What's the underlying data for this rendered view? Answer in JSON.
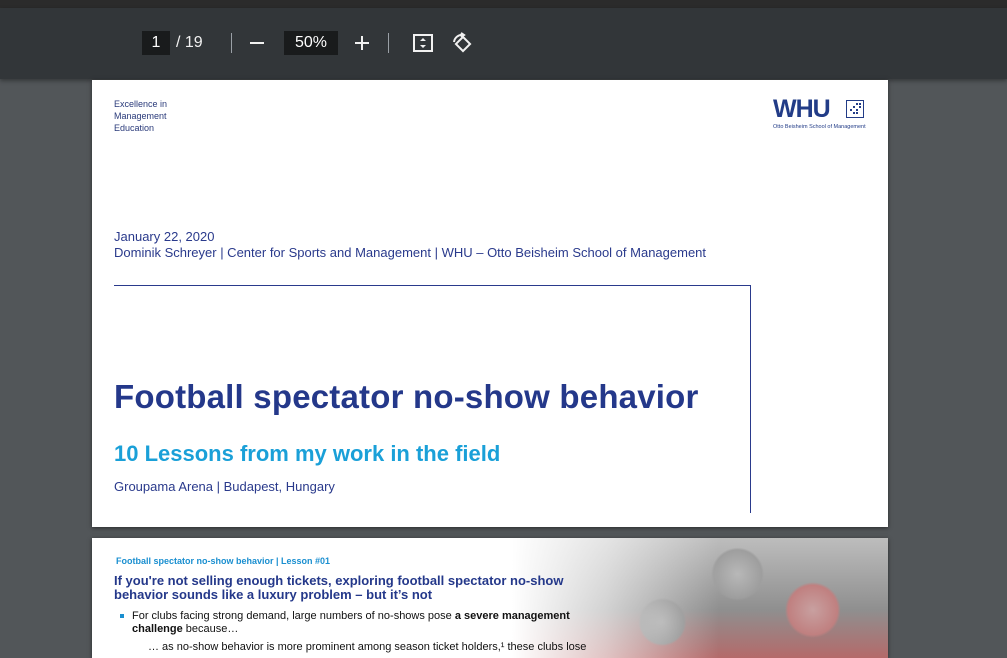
{
  "toolbar": {
    "current_page": "1",
    "total_pages": "/ 19",
    "zoom": "50%"
  },
  "page1": {
    "tagline": [
      "Excellence in",
      "Management",
      "Education"
    ],
    "logo_text": "WHU",
    "logo_sub": "Otto Beisheim School of Management",
    "date": "January 22, 2020",
    "author_line": "Dominik Schreyer | Center for Sports and Management | WHU – Otto Beisheim School of Management",
    "title": "Football spectator no-show behavior",
    "subtitle": "10 Lessons from my work in the field",
    "venue": "Groupama Arena | Budapest, Hungary"
  },
  "page2": {
    "header": "Football spectator no-show behavior | Lesson #01",
    "title_line1": "If you're not selling enough tickets, exploring football spectator no-show",
    "title_line2": "behavior sounds like a luxury problem – but it’s not",
    "bullet_pre": "For clubs facing strong demand, large numbers of no-shows pose ",
    "bullet_bold": "a severe management",
    "bullet_bold2": "challenge",
    "bullet_post": " because…",
    "sub_bullet": "… as no-show behavior is more prominent among season ticket holders,¹ these clubs lose"
  },
  "colors": {
    "toolbar_bg": "#323639",
    "viewer_bg": "#525659",
    "whu_blue": "#24388a",
    "accent_cyan": "#1aa0d8"
  },
  "icons": [
    "zoom-out-icon",
    "zoom-in-icon",
    "fit-to-page-icon",
    "rotate-icon"
  ]
}
